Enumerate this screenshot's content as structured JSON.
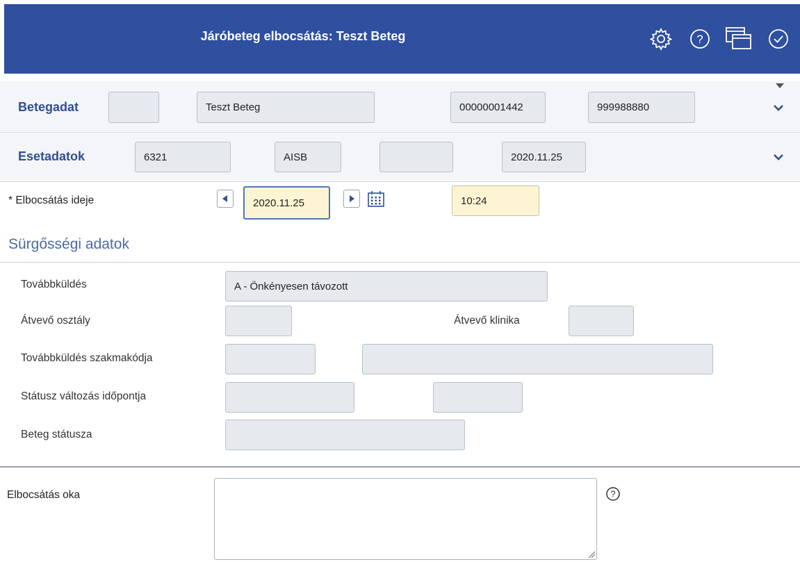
{
  "header": {
    "title": "Járóbeteg elbocsátás: Teszt Beteg",
    "icons": [
      "gear-icon",
      "help-icon",
      "windows-icon",
      "check-circle-icon"
    ],
    "bg_color": "#2f4f9f"
  },
  "patient": {
    "label": "Betegadat",
    "field1": "",
    "name": "Teszt Beteg",
    "id_number": "00000001442",
    "taj": "999988880"
  },
  "case": {
    "label": "Esetadatok",
    "code": "6321",
    "unit": "AISB",
    "blank": "",
    "date": "2020.11.25"
  },
  "discharge": {
    "time_label": "* Elbocsátás ideje",
    "date": "2020.11.25",
    "time": "10:24"
  },
  "emergency": {
    "heading": "Sürgősségi adatok",
    "referral_label": "Továbbküldés",
    "referral_value": "A - Önkényesen távozott",
    "receiving_ward_label": "Átvevő osztály",
    "receiving_ward_value": "",
    "receiving_clinic_label": "Átvevő klinika",
    "receiving_clinic_value": "",
    "specialty_label": "Továbbküldés szakmakódja",
    "specialty_code": "",
    "specialty_name": "",
    "status_change_label": "Státusz változás időpontja",
    "status_change_date": "",
    "status_change_time": "",
    "patient_status_label": "Beteg státusza",
    "patient_status_value": ""
  },
  "reason": {
    "label": "Elbocsátás oka",
    "value": ""
  }
}
